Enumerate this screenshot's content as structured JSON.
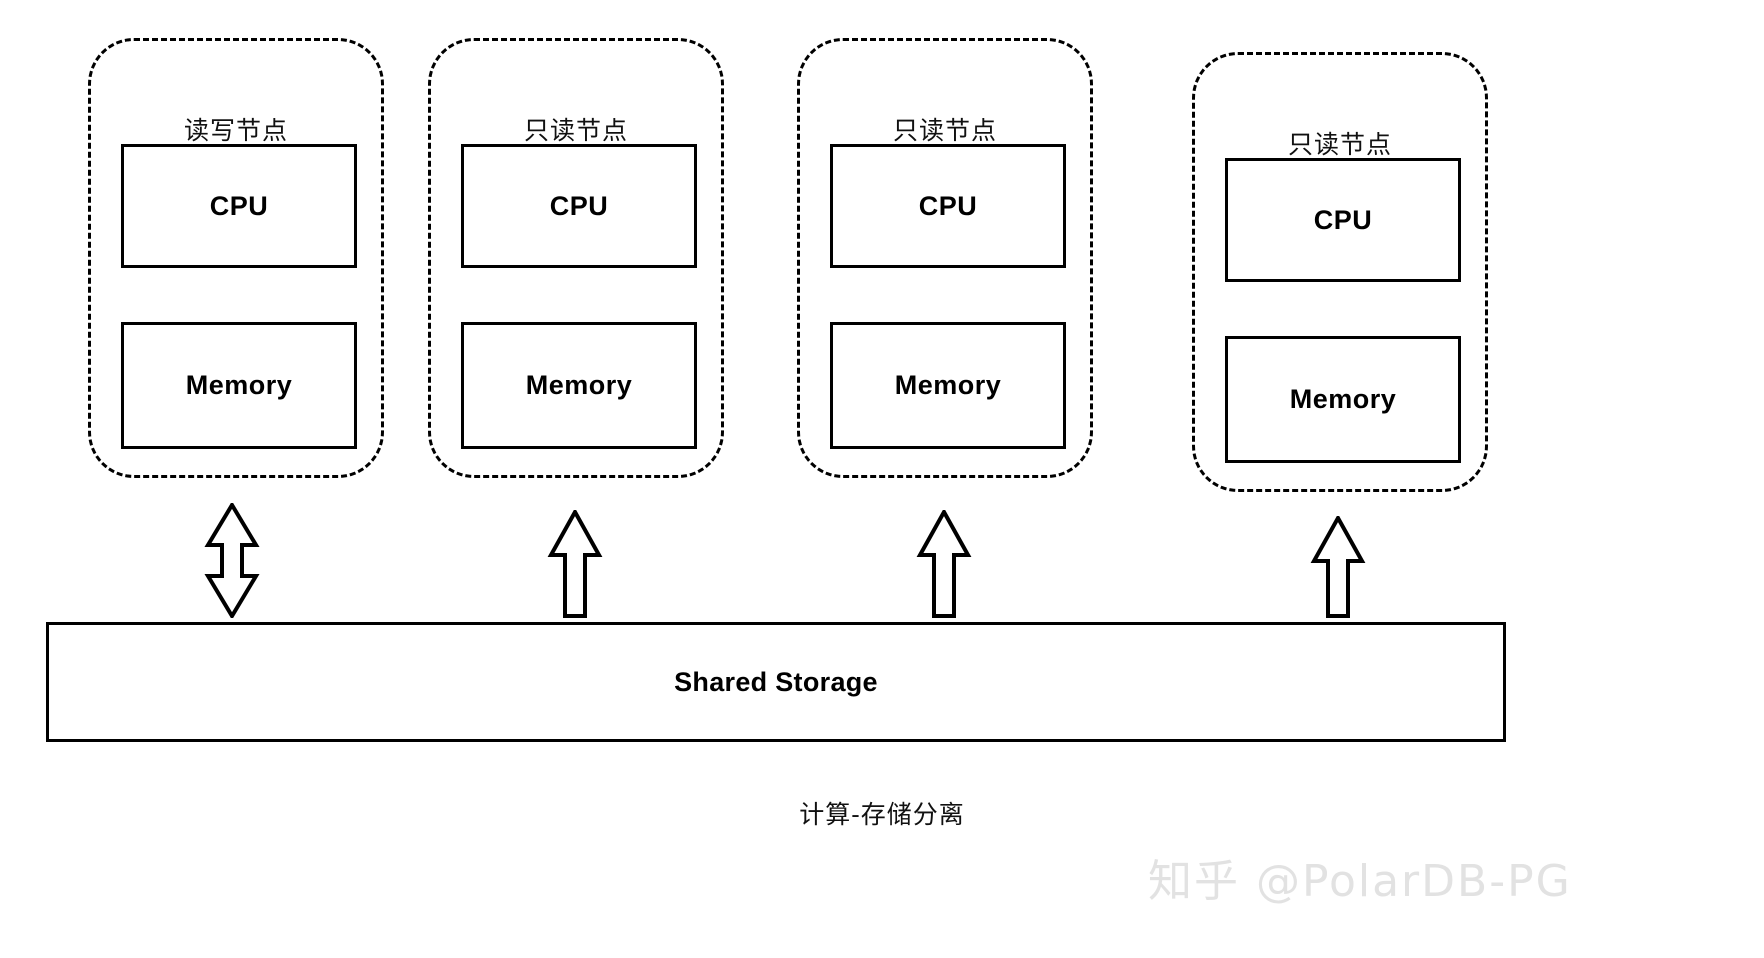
{
  "diagram": {
    "caption": "计算-存储分离",
    "watermark": "知乎 @PolarDB-PG",
    "colors": {
      "stroke": "#000000",
      "background": "#ffffff",
      "watermark": "#e2e2e2"
    },
    "nodes": [
      {
        "title": "读写节点",
        "cpu_label": "CPU",
        "memory_label": "Memory",
        "arrow": "double-headed-vertical-arrow"
      },
      {
        "title": "只读节点",
        "cpu_label": "CPU",
        "memory_label": "Memory",
        "arrow": "up-arrow"
      },
      {
        "title": "只读节点",
        "cpu_label": "CPU",
        "memory_label": "Memory",
        "arrow": "up-arrow"
      },
      {
        "title": "只读节点",
        "cpu_label": "CPU",
        "memory_label": "Memory",
        "arrow": "up-arrow"
      }
    ],
    "storage": {
      "label": "Shared Storage"
    }
  }
}
